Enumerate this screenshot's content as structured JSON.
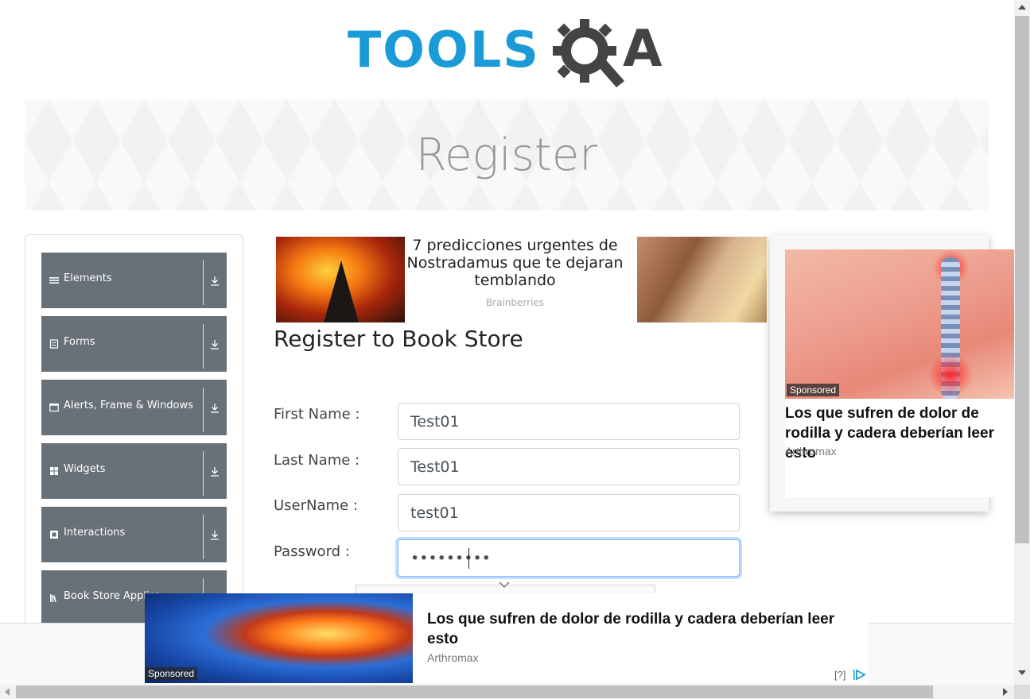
{
  "header": {
    "logo_text": "TOOLS",
    "logo_suffix": "A"
  },
  "banner": {
    "title": "Register"
  },
  "sidebar": {
    "groups": [
      {
        "label": "Elements",
        "icon": "hamburger-icon"
      },
      {
        "label": "Forms",
        "icon": "form-icon"
      },
      {
        "label": "Alerts, Frame & Windows",
        "icon": "window-icon"
      },
      {
        "label": "Widgets",
        "icon": "grid-icon"
      },
      {
        "label": "Interactions",
        "icon": "interaction-icon"
      },
      {
        "label": "Book Store Applica",
        "icon": "book-icon"
      }
    ]
  },
  "ad_top": {
    "headline": "7 predicciones urgentes de Nostradamus que te dejaran temblando",
    "source": "Brainberries"
  },
  "ad_card": {
    "sponsored": "Sponsored",
    "title": "Los que sufren de dolor de rodilla y cadera deberían leer esto",
    "source": "Arthromax"
  },
  "form": {
    "title": "Register to Book Store",
    "fields": [
      {
        "label": "First Name :",
        "value": "Test01"
      },
      {
        "label": "Last Name :",
        "value": "Test01"
      },
      {
        "label": "UserName :",
        "value": "test01"
      },
      {
        "label": "Password :",
        "value": "•••••••••"
      }
    ]
  },
  "ad_bottom": {
    "sponsored": "Sponsored",
    "title": "Los que sufren de dolor de rodilla y cadera deberían leer esto",
    "source": "Arthromax",
    "help": "[?]"
  },
  "colors": {
    "brand_blue": "#1a9bd7",
    "sidebar_group": "#687078",
    "input_focus": "#80bdff"
  }
}
